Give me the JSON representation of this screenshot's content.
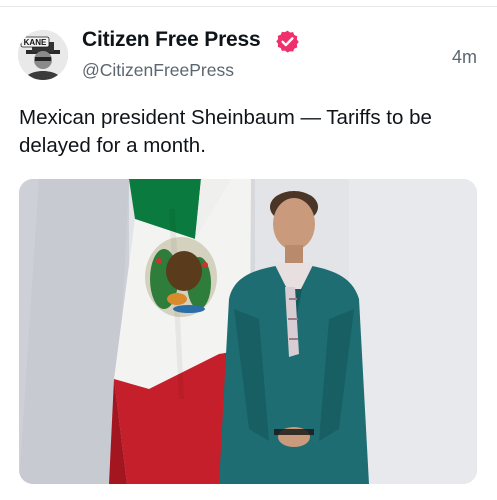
{
  "post": {
    "author_name": "Citizen Free Press",
    "handle": "@CitizenFreePress",
    "timestamp": "4m",
    "text": "Mexican president Sheinbaum — Tariffs to be delayed for a month.",
    "avatar_label": "KANE",
    "verified_icon": "verified-badge-icon",
    "verified_color": "#f0306a"
  },
  "colors": {
    "text_primary": "#0f1419",
    "text_secondary": "#5c6670",
    "flag_green": "#0a7a3e",
    "flag_red": "#c41f2b",
    "jacket_teal": "#1d6d72"
  }
}
